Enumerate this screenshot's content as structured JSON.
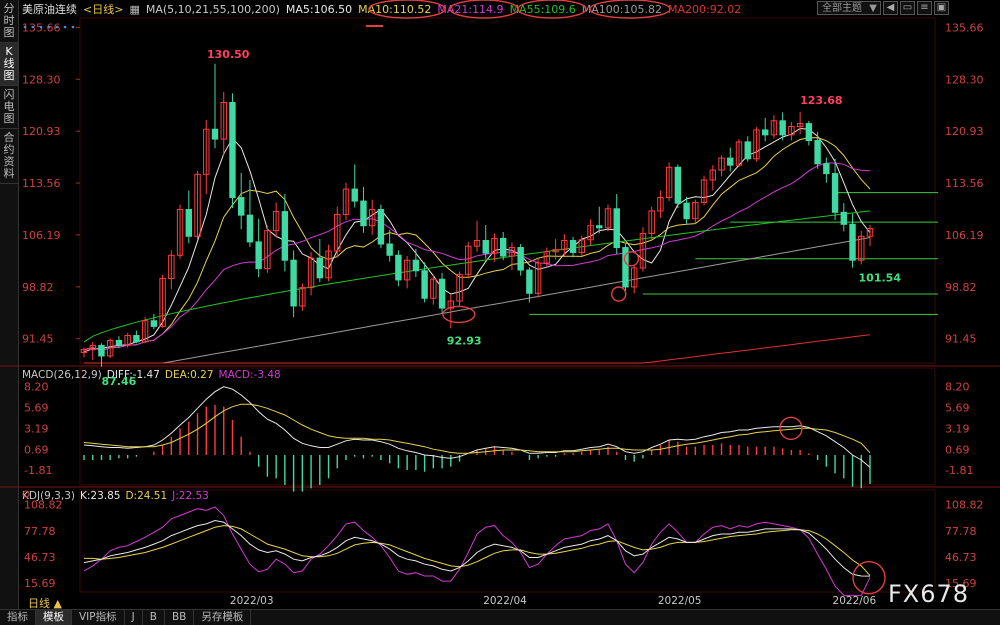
{
  "sidebar": {
    "tabs": [
      "分时图",
      "K线图",
      "闪电图",
      "合约资料"
    ],
    "active_index": 1
  },
  "header": {
    "symbol": "美原油连续",
    "period": "<日线>",
    "ma_params": "MA(5,10,21,55,100,200)",
    "ma_values": [
      {
        "label": "MA5:106.50",
        "color": "#e8e8e8"
      },
      {
        "label": "MA10:110.52",
        "color": "#e8d24a"
      },
      {
        "label": "MA21:114.9",
        "color": "#d23ad2"
      },
      {
        "label": "MA55:109.6",
        "color": "#25c225"
      },
      {
        "label": "MA100:105.82",
        "color": "#9a9a9a"
      },
      {
        "label": "MA200:92.02",
        "color": "#e03030"
      }
    ],
    "theme_button": "全部主题"
  },
  "price_axis": [
    "135.66",
    "128.30",
    "120.93",
    "113.56",
    "106.19",
    "98.82",
    "91.45"
  ],
  "macd_axis": [
    "8.20",
    "5.69",
    "3.19",
    "0.69",
    "-1.81"
  ],
  "kdj_axis": [
    "108.82",
    "77.78",
    "46.73",
    "15.69"
  ],
  "macd_header": [
    {
      "text": "MACD(26,12,9)",
      "color": "#c8c8c8"
    },
    {
      "text": "DIFF:-1.47",
      "color": "#e8e8e8"
    },
    {
      "text": "DEA:0.27",
      "color": "#e8d24a"
    },
    {
      "text": "MACD:-3.48",
      "color": "#d23ad2"
    }
  ],
  "kdj_header": [
    {
      "text": "KDJ(9,3,3)",
      "color": "#c8c8c8"
    },
    {
      "text": "K:23.85",
      "color": "#e8e8e8"
    },
    {
      "text": "D:24.51",
      "color": "#e8d24a"
    },
    {
      "text": "J:22.53",
      "color": "#d23ad2"
    }
  ],
  "x_labels": [
    "2022/03",
    "2022/04",
    "2022/05",
    "2022/06"
  ],
  "bottom_tabs": [
    "指标",
    "模板",
    "VIP指标",
    "J",
    "B",
    "BB",
    "另存模板"
  ],
  "bottom_active": 1,
  "period_label": "日线 ▲",
  "watermark": "FX678",
  "chart_data": {
    "type": "candlestick",
    "ylim": [
      88,
      137
    ],
    "annotations": [
      {
        "text": "130.50",
        "color": "#ff4060"
      },
      {
        "text": "87.46",
        "color": "#40e080"
      },
      {
        "text": "92.93",
        "color": "#40e080"
      },
      {
        "text": "123.68",
        "color": "#ff4060"
      },
      {
        "text": "101.54",
        "color": "#40e080"
      }
    ],
    "levels": [
      112.2,
      108.0,
      102.8,
      97.8,
      94.9
    ],
    "candles": [
      [
        89.5,
        90.2,
        88.8,
        89.9
      ],
      [
        89.9,
        91.0,
        88.4,
        90.5
      ],
      [
        90.5,
        90.8,
        87.46,
        89.0
      ],
      [
        89.0,
        91.5,
        88.7,
        91.2
      ],
      [
        91.2,
        91.8,
        90.1,
        90.6
      ],
      [
        90.6,
        92.3,
        90.2,
        91.9
      ],
      [
        91.9,
        92.6,
        90.8,
        91.0
      ],
      [
        91.0,
        94.5,
        90.8,
        94.0
      ],
      [
        94.0,
        95.0,
        92.8,
        93.2
      ],
      [
        93.2,
        100.5,
        93.0,
        100.0
      ],
      [
        100.0,
        104.0,
        98.5,
        103.3
      ],
      [
        103.3,
        110.5,
        102.8,
        109.8
      ],
      [
        109.8,
        112.5,
        105.0,
        106.0
      ],
      [
        106.0,
        115.3,
        105.5,
        114.8
      ],
      [
        114.8,
        122.5,
        112.0,
        121.2
      ],
      [
        121.2,
        130.5,
        118.5,
        119.8
      ],
      [
        119.8,
        126.5,
        117.5,
        125.0
      ],
      [
        125.0,
        126.3,
        110.0,
        111.5
      ],
      [
        111.5,
        115.0,
        107.0,
        109.0
      ],
      [
        109.0,
        114.0,
        104.5,
        105.2
      ],
      [
        105.2,
        108.5,
        100.2,
        101.4
      ],
      [
        101.4,
        107.5,
        100.8,
        106.8
      ],
      [
        106.8,
        110.8,
        105.8,
        109.5
      ],
      [
        109.5,
        112.0,
        101.0,
        102.6
      ],
      [
        102.6,
        104.0,
        94.5,
        96.1
      ],
      [
        96.1,
        99.3,
        95.4,
        98.7
      ],
      [
        98.7,
        103.8,
        97.6,
        102.9
      ],
      [
        102.9,
        105.6,
        99.5,
        100.1
      ],
      [
        100.1,
        104.8,
        99.6,
        103.9
      ],
      [
        103.9,
        110.2,
        103.0,
        109.1
      ],
      [
        109.1,
        113.6,
        108.3,
        112.7
      ],
      [
        112.7,
        116.2,
        110.1,
        111.0
      ],
      [
        111.0,
        113.0,
        106.5,
        107.5
      ],
      [
        107.5,
        111.2,
        106.2,
        109.8
      ],
      [
        109.8,
        110.5,
        104.3,
        104.9
      ],
      [
        104.9,
        106.9,
        102.4,
        103.3
      ],
      [
        103.3,
        104.0,
        98.9,
        99.8
      ],
      [
        99.8,
        103.2,
        98.6,
        102.6
      ],
      [
        102.6,
        104.2,
        100.2,
        101.1
      ],
      [
        101.1,
        102.3,
        96.6,
        97.2
      ],
      [
        97.2,
        100.6,
        96.3,
        99.9
      ],
      [
        99.9,
        100.8,
        95.1,
        95.8
      ],
      [
        95.8,
        97.7,
        92.93,
        96.8
      ],
      [
        96.8,
        101.0,
        96.0,
        100.6
      ],
      [
        100.6,
        105.2,
        100.0,
        104.6
      ],
      [
        104.6,
        108.2,
        103.8,
        105.4
      ],
      [
        105.4,
        107.6,
        102.8,
        103.6
      ],
      [
        103.6,
        106.4,
        102.4,
        105.7
      ],
      [
        105.7,
        106.6,
        102.6,
        103.2
      ],
      [
        103.2,
        105.1,
        101.2,
        104.4
      ],
      [
        104.4,
        104.9,
        100.4,
        101.2
      ],
      [
        101.2,
        101.6,
        96.6,
        97.9
      ],
      [
        97.9,
        102.8,
        97.3,
        102.2
      ],
      [
        102.2,
        104.4,
        101.6,
        103.8
      ],
      [
        103.8,
        105.6,
        102.7,
        104.1
      ],
      [
        104.1,
        106.3,
        103.2,
        105.4
      ],
      [
        105.4,
        105.9,
        103.0,
        103.7
      ],
      [
        103.7,
        106.1,
        103.2,
        105.5
      ],
      [
        105.5,
        108.4,
        104.7,
        107.5
      ],
      [
        107.5,
        110.2,
        106.4,
        107.2
      ],
      [
        107.2,
        110.5,
        106.7,
        109.9
      ],
      [
        109.9,
        112.0,
        103.5,
        104.4
      ],
      [
        104.4,
        104.9,
        97.5,
        98.8
      ],
      [
        98.8,
        102.0,
        97.9,
        101.5
      ],
      [
        101.5,
        107.3,
        101.0,
        106.4
      ],
      [
        106.4,
        110.2,
        105.6,
        109.6
      ],
      [
        109.6,
        112.5,
        108.6,
        111.5
      ],
      [
        111.5,
        116.5,
        111.0,
        115.8
      ],
      [
        115.8,
        116.2,
        110.0,
        110.7
      ],
      [
        110.7,
        111.6,
        107.7,
        108.5
      ],
      [
        108.5,
        111.2,
        107.8,
        110.8
      ],
      [
        110.8,
        114.6,
        110.4,
        114.0
      ],
      [
        114.0,
        116.1,
        112.5,
        115.4
      ],
      [
        115.4,
        117.5,
        114.5,
        117.1
      ],
      [
        117.1,
        118.6,
        115.2,
        116.1
      ],
      [
        116.1,
        119.8,
        115.8,
        119.4
      ],
      [
        119.4,
        120.2,
        116.6,
        117.0
      ],
      [
        117.0,
        121.5,
        116.6,
        121.1
      ],
      [
        121.1,
        122.8,
        119.5,
        120.4
      ],
      [
        120.4,
        123.2,
        119.9,
        122.4
      ],
      [
        122.4,
        123.6,
        119.6,
        120.4
      ],
      [
        120.4,
        122.2,
        119.6,
        121.6
      ],
      [
        121.6,
        123.68,
        120.5,
        122.0
      ],
      [
        122.0,
        122.4,
        118.9,
        119.6
      ],
      [
        119.6,
        120.8,
        115.6,
        116.3
      ],
      [
        116.3,
        117.2,
        113.6,
        114.9
      ],
      [
        114.9,
        117.0,
        108.3,
        109.4
      ],
      [
        109.4,
        110.7,
        106.7,
        107.7
      ],
      [
        107.7,
        109.2,
        101.54,
        102.6
      ],
      [
        102.6,
        106.8,
        102.0,
        106.0
      ],
      [
        106.0,
        107.6,
        104.6,
        107.1
      ]
    ],
    "ma": {
      "ma5": [
        89.6,
        90.0,
        90.1,
        90.3,
        90.5,
        90.6,
        91.0,
        91.4,
        92.0,
        93.8,
        96.2,
        98.9,
        101.6,
        105.3,
        109.1,
        114.3,
        117.7,
        119.9,
        118.6,
        115.3,
        111.3,
        107.0,
        106.0,
        105.4,
        105.3,
        103.5,
        102.9,
        101.9,
        101.4,
        104.0,
        106.2,
        108.0,
        108.2,
        109.0,
        109.8,
        108.2,
        106.1,
        105.1,
        103.6,
        102.0,
        100.4,
        98.6,
        97.8,
        98.1,
        98.6,
        100.6,
        102.4,
        104.0,
        104.2,
        104.0,
        103.4,
        101.9,
        101.3,
        101.6,
        102.0,
        103.5,
        104.5,
        105.6,
        106.0,
        106.8,
        107.0,
        106.9,
        105.4,
        103.8,
        102.7,
        102.2,
        104.0,
        108.1,
        110.5,
        111.3,
        111.6,
        111.5,
        111.8,
        113.2,
        114.7,
        116.1,
        117.5,
        118.0,
        118.7,
        119.4,
        120.1,
        120.5,
        121.3,
        121.2,
        120.2,
        118.6,
        116.6,
        113.6,
        110.5,
        108.1,
        106.5
      ]
    },
    "macd": {
      "ylim": [
        -3.6,
        9.0
      ],
      "diff": [
        1.2,
        1.1,
        1.0,
        0.9,
        0.9,
        0.8,
        0.9,
        1.0,
        1.2,
        1.8,
        2.6,
        3.6,
        4.5,
        5.6,
        6.7,
        7.6,
        8.2,
        7.9,
        7.2,
        6.3,
        5.2,
        4.3,
        3.8,
        3.0,
        2.0,
        1.4,
        1.1,
        0.9,
        0.9,
        1.3,
        1.7,
        1.9,
        1.8,
        1.8,
        1.6,
        1.3,
        0.8,
        0.5,
        0.3,
        0.0,
        -0.1,
        -0.3,
        -0.4,
        -0.2,
        0.2,
        0.6,
        0.8,
        1.0,
        0.9,
        0.8,
        0.6,
        0.2,
        0.2,
        0.3,
        0.3,
        0.5,
        0.5,
        0.7,
        0.9,
        1.0,
        1.3,
        1.0,
        0.4,
        0.2,
        0.4,
        0.9,
        1.3,
        1.8,
        1.9,
        1.8,
        1.9,
        2.2,
        2.4,
        2.7,
        2.8,
        3.0,
        3.0,
        3.2,
        3.3,
        3.4,
        3.4,
        3.4,
        3.5,
        3.3,
        2.8,
        2.3,
        1.6,
        0.9,
        0.0,
        -0.6,
        -1.47
      ],
      "dea": [
        1.5,
        1.4,
        1.3,
        1.2,
        1.1,
        1.0,
        1.0,
        1.0,
        1.0,
        1.2,
        1.5,
        2.0,
        2.5,
        3.1,
        3.8,
        4.6,
        5.3,
        5.8,
        6.1,
        6.1,
        5.9,
        5.6,
        5.2,
        4.8,
        4.2,
        3.6,
        3.1,
        2.7,
        2.3,
        2.1,
        2.0,
        2.0,
        2.0,
        1.9,
        1.9,
        1.8,
        1.6,
        1.4,
        1.2,
        1.0,
        0.7,
        0.5,
        0.3,
        0.2,
        0.2,
        0.3,
        0.4,
        0.5,
        0.6,
        0.6,
        0.6,
        0.5,
        0.4,
        0.4,
        0.4,
        0.4,
        0.4,
        0.5,
        0.6,
        0.7,
        0.8,
        0.8,
        0.7,
        0.6,
        0.6,
        0.6,
        0.7,
        0.9,
        1.1,
        1.3,
        1.4,
        1.6,
        1.8,
        2.0,
        2.2,
        2.4,
        2.5,
        2.7,
        2.8,
        2.9,
        3.0,
        3.1,
        3.2,
        3.2,
        3.1,
        3.0,
        2.7,
        2.3,
        1.9,
        1.4,
        0.27
      ]
    },
    "kdj": {
      "ylim": [
        5,
        112
      ],
      "k": [
        40,
        42,
        44,
        48,
        50,
        52,
        55,
        58,
        62,
        66,
        72,
        76,
        80,
        84,
        86,
        90,
        88,
        80,
        72,
        62,
        55,
        52,
        54,
        50,
        44,
        42,
        46,
        48,
        52,
        58,
        66,
        70,
        68,
        66,
        62,
        56,
        48,
        44,
        42,
        38,
        36,
        32,
        30,
        34,
        42,
        52,
        58,
        62,
        60,
        58,
        54,
        46,
        46,
        50,
        54,
        58,
        60,
        62,
        66,
        68,
        72,
        66,
        54,
        48,
        50,
        58,
        64,
        70,
        68,
        64,
        64,
        68,
        72,
        74,
        74,
        76,
        76,
        78,
        80,
        80,
        80,
        80,
        79,
        75,
        66,
        56,
        44,
        34,
        26,
        24,
        23.85
      ],
      "d": [
        45,
        45,
        44,
        45,
        46,
        48,
        50,
        52,
        55,
        58,
        62,
        66,
        70,
        74,
        78,
        82,
        84,
        83,
        80,
        74,
        68,
        62,
        59,
        56,
        52,
        48,
        47,
        47,
        48,
        51,
        56,
        61,
        63,
        64,
        63,
        61,
        57,
        53,
        49,
        45,
        42,
        39,
        36,
        35,
        37,
        41,
        46,
        51,
        54,
        55,
        55,
        52,
        50,
        50,
        51,
        53,
        55,
        57,
        60,
        62,
        65,
        66,
        62,
        58,
        55,
        56,
        58,
        62,
        64,
        64,
        64,
        65,
        67,
        69,
        71,
        72,
        73,
        74,
        76,
        77,
        78,
        79,
        79,
        78,
        74,
        68,
        60,
        52,
        43,
        36,
        24.51
      ],
      "j": [
        30,
        36,
        44,
        54,
        58,
        60,
        65,
        70,
        76,
        82,
        92,
        96,
        100,
        104,
        102,
        106,
        96,
        74,
        56,
        38,
        29,
        32,
        44,
        38,
        28,
        30,
        44,
        50,
        60,
        72,
        86,
        88,
        78,
        70,
        60,
        46,
        30,
        26,
        28,
        24,
        24,
        18,
        18,
        32,
        52,
        74,
        82,
        84,
        72,
        64,
        52,
        34,
        38,
        50,
        60,
        68,
        70,
        72,
        78,
        80,
        86,
        66,
        38,
        28,
        40,
        62,
        76,
        86,
        76,
        64,
        64,
        74,
        82,
        84,
        80,
        84,
        82,
        86,
        88,
        86,
        84,
        82,
        79,
        69,
        50,
        32,
        12,
        -2,
        -8,
        0,
        22.53
      ]
    }
  }
}
